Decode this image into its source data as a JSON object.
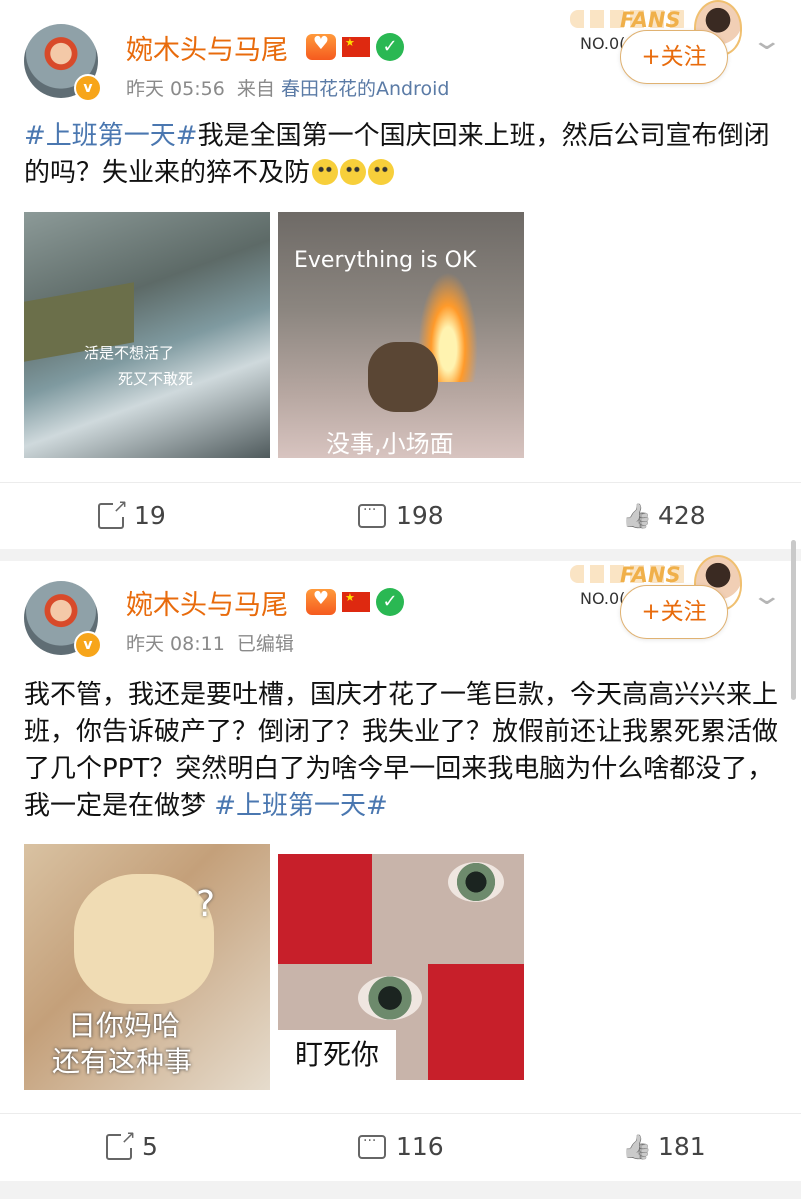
{
  "posts": [
    {
      "username": "婉木头与马尾",
      "vip_level": "VIP6",
      "time": "昨天 05:56",
      "source_prefix": "来自",
      "source": "春田花花的Android",
      "fans_label": "FANS",
      "fans_no": "NO.0(",
      "follow_label": "+关注",
      "text_tag": "#上班第一天#",
      "text": "我是全国第一个国庆回来上班，然后公司宣布倒闭的吗？失业来的猝不及防",
      "images": [
        {
          "caption1": "活是不想活了",
          "caption2": "死又不敢死"
        },
        {
          "caption_top": "Everything is OK",
          "caption_bottom": "没事,小场面"
        }
      ],
      "share_count": "19",
      "comment_count": "198",
      "like_count": "428"
    },
    {
      "username": "婉木头与马尾",
      "vip_level": "VIP6",
      "time": "昨天 08:11",
      "edited": "已编辑",
      "fans_label": "FANS",
      "fans_no": "NO.0(",
      "follow_label": "+关注",
      "text": "我不管，我还是要吐槽，国庆才花了一笔巨款，今天高高兴兴来上班，你告诉破产了？倒闭了？我失业了？放假前还让我累死累活做了几个PPT？突然明白了为啥今早一回来我电脑为什么啥都没了，我一定是在做梦 ",
      "text_tag": "#上班第一天#",
      "images": [
        {
          "caption1": "日你妈哈",
          "caption2": "还有这种事",
          "mark": "?"
        },
        {
          "caption": "盯死你"
        }
      ],
      "share_count": "5",
      "comment_count": "116",
      "like_count": "181"
    }
  ]
}
